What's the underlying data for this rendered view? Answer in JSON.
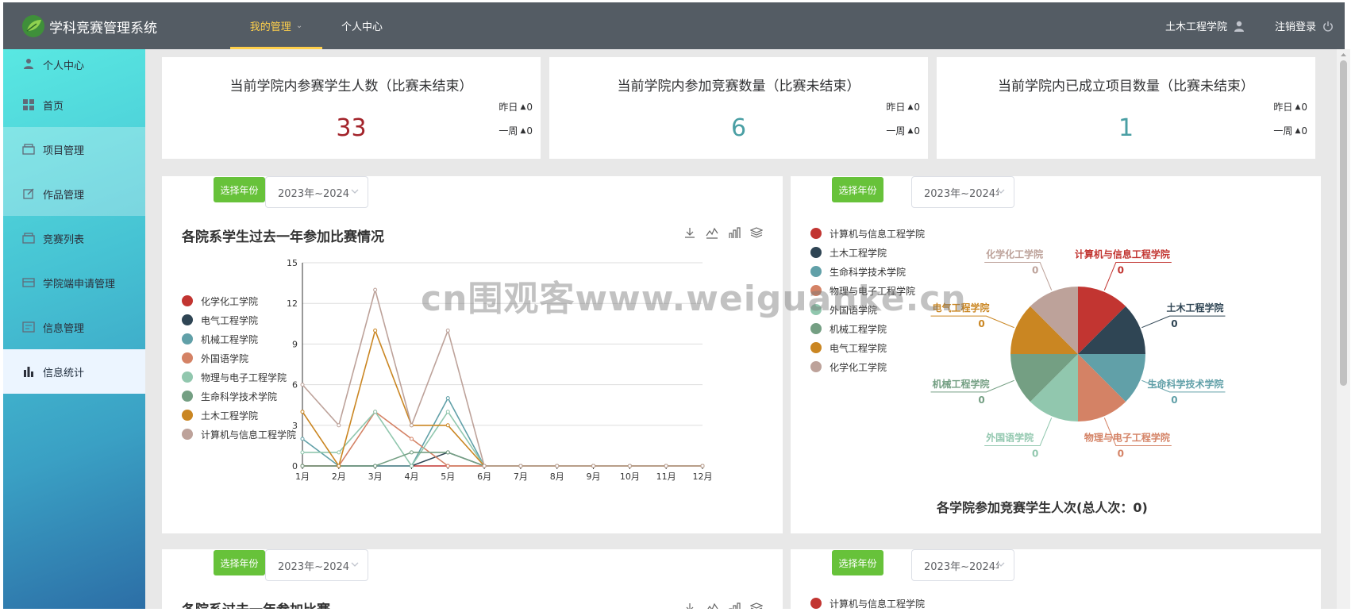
{
  "app": {
    "title": "学科竞赛管理系统"
  },
  "topnav": {
    "mine": "我的管理",
    "center": "个人中心"
  },
  "user": {
    "name": "土木工程学院",
    "logout": "注销登录"
  },
  "sidebar": {
    "items": [
      {
        "label": "个人中心",
        "icon": "user-icon"
      },
      {
        "label": "首页",
        "icon": "grid-icon"
      },
      {
        "label": "项目管理",
        "icon": "box-icon"
      },
      {
        "label": "作品管理",
        "icon": "edit-icon"
      },
      {
        "label": "竞赛列表",
        "icon": "box-icon"
      },
      {
        "label": "学院端申请管理",
        "icon": "card-icon"
      },
      {
        "label": "信息管理",
        "icon": "doc-icon"
      },
      {
        "label": "信息统计",
        "icon": "bar-chart-icon"
      }
    ]
  },
  "stats": [
    {
      "title": "当前学院内参赛学生人数（比赛未结束）",
      "value": "33",
      "color": "#a3242b",
      "yesterday_label": "昨日",
      "yesterday": "0",
      "week_label": "一周",
      "week": "0"
    },
    {
      "title": "当前学院内参加竞赛数量（比赛未结束）",
      "value": "6",
      "color": "#4a9fa4",
      "yesterday_label": "昨日",
      "yesterday": "0",
      "week_label": "一周",
      "week": "0"
    },
    {
      "title": "当前学院内已成立项目数量（比赛未结束）",
      "value": "1",
      "color": "#4a9fa4",
      "yesterday_label": "昨日",
      "yesterday": "0",
      "week_label": "一周",
      "week": "0"
    }
  ],
  "controls": {
    "year_button": "选择年份",
    "year_value_1": "2023年~2024",
    "year_value_2": "2023年~2024年"
  },
  "line_panel": {
    "title": "各院系学生过去一年参加比赛情况"
  },
  "pie_panel": {
    "caption": "各学院参加竞赛学生人次(总人次：0)"
  },
  "bottom_panel": {
    "title": "各院系过去一年参加比赛"
  },
  "bottom_legend_first": "计算机与信息工程学院",
  "watermark": "cn围观客www.weiguanke.cn",
  "chart_data": [
    {
      "type": "line",
      "title": "各院系学生过去一年参加比赛情况",
      "categories": [
        "1月",
        "2月",
        "3月",
        "4月",
        "5月",
        "6月",
        "7月",
        "8月",
        "9月",
        "10月",
        "11月",
        "12月"
      ],
      "ylim": [
        0,
        15
      ],
      "yticks": [
        0,
        3,
        6,
        9,
        12,
        15
      ],
      "grid": true,
      "legend": "left",
      "series": [
        {
          "name": "化学化工学院",
          "color": "#c23531",
          "values": [
            0,
            0,
            0,
            0,
            0,
            0,
            0,
            0,
            0,
            0,
            0,
            0
          ]
        },
        {
          "name": "电气工程学院",
          "color": "#2f4554",
          "values": [
            0,
            0,
            0,
            0,
            1,
            0,
            0,
            0,
            0,
            0,
            0,
            0
          ]
        },
        {
          "name": "机械工程学院",
          "color": "#61a0a8",
          "values": [
            2,
            0,
            0,
            0,
            5,
            0,
            0,
            0,
            0,
            0,
            0,
            0
          ]
        },
        {
          "name": "外国语学院",
          "color": "#d48265",
          "values": [
            0,
            0,
            4,
            2,
            0,
            0,
            0,
            0,
            0,
            0,
            0,
            0
          ]
        },
        {
          "name": "物理与电子工程学院",
          "color": "#91c7ae",
          "values": [
            1,
            1,
            4,
            0,
            4,
            0,
            0,
            0,
            0,
            0,
            0,
            0
          ]
        },
        {
          "name": "生命科学技术学院",
          "color": "#749f83",
          "values": [
            0,
            0,
            0,
            1,
            1,
            0,
            0,
            0,
            0,
            0,
            0,
            0
          ]
        },
        {
          "name": "土木工程学院",
          "color": "#ca8622",
          "values": [
            4,
            0,
            10,
            3,
            3,
            0,
            0,
            0,
            0,
            0,
            0,
            0
          ]
        },
        {
          "name": "计算机与信息工程学院",
          "color": "#bda29a",
          "values": [
            6,
            3,
            13,
            3,
            10,
            0,
            0,
            0,
            0,
            0,
            0,
            0
          ]
        }
      ]
    },
    {
      "type": "pie",
      "title": "各学院参加竞赛学生人次(总人次：0)",
      "legend": "left",
      "slices": [
        {
          "name": "计算机与信息工程学院",
          "value": 0,
          "color": "#c23531"
        },
        {
          "name": "土木工程学院",
          "value": 0,
          "color": "#2f4554"
        },
        {
          "name": "生命科学技术学院",
          "value": 0,
          "color": "#61a0a8"
        },
        {
          "name": "物理与电子工程学院",
          "value": 0,
          "color": "#d48265"
        },
        {
          "name": "外国语学院",
          "value": 0,
          "color": "#91c7ae"
        },
        {
          "name": "机械工程学院",
          "value": 0,
          "color": "#749f83"
        },
        {
          "name": "电气工程学院",
          "value": 0,
          "color": "#ca8622"
        },
        {
          "name": "化学化工学院",
          "value": 0,
          "color": "#bda29a"
        }
      ]
    }
  ]
}
